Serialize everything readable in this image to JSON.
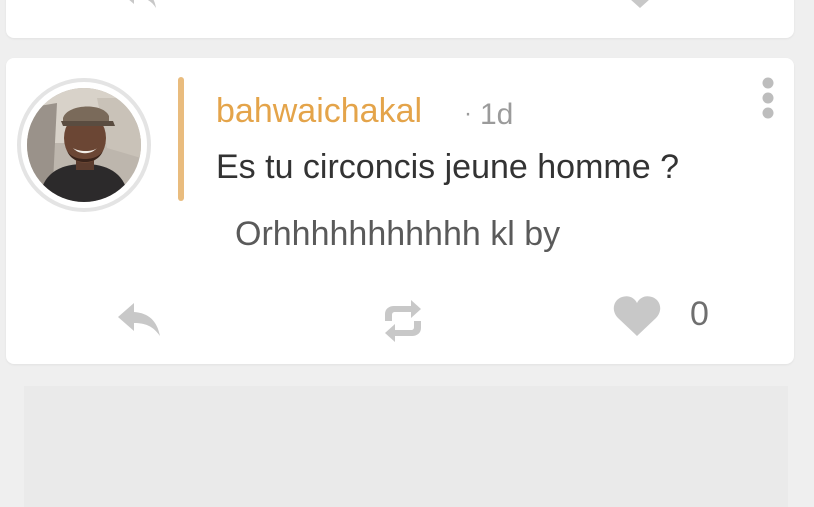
{
  "post": {
    "author": "bahwaichakal",
    "time_separator": "·",
    "time": "1d",
    "quoted_text": "Es tu circoncis jeune homme ?",
    "reply_text": "Orhhhhhhhhhhh kl by",
    "like_count": "0",
    "menu_icon": "more-vertical-icon"
  },
  "actions": {
    "reply_icon": "reply-icon",
    "repost_icon": "repost-icon",
    "like_icon": "heart-icon"
  },
  "colors": {
    "background": "#efefef",
    "card": "#ffffff",
    "username": "#e4a44a",
    "quote_bar": "#e9bc7e",
    "icon": "#c8c8c8",
    "text": "#333333"
  }
}
